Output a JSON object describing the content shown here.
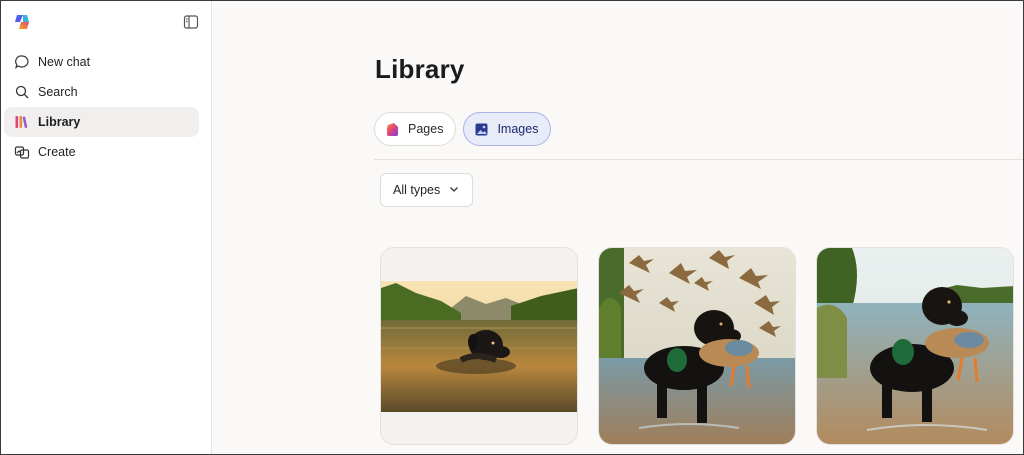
{
  "sidebar": {
    "items": [
      {
        "label": "New chat",
        "icon": "chat-bubble-icon"
      },
      {
        "label": "Search",
        "icon": "search-icon"
      },
      {
        "label": "Library",
        "icon": "library-icon",
        "active": true
      },
      {
        "label": "Create",
        "icon": "create-icon"
      }
    ]
  },
  "main": {
    "title": "Library",
    "tabs": [
      {
        "label": "Pages",
        "icon": "pages-icon"
      },
      {
        "label": "Images",
        "icon": "images-icon",
        "active": true
      }
    ],
    "filter": {
      "label": "All types"
    }
  },
  "colors": {
    "accent": "#4f5fd0",
    "active_tab_bg": "#e8ebf8",
    "sidebar_active_bg": "#f0efee"
  }
}
